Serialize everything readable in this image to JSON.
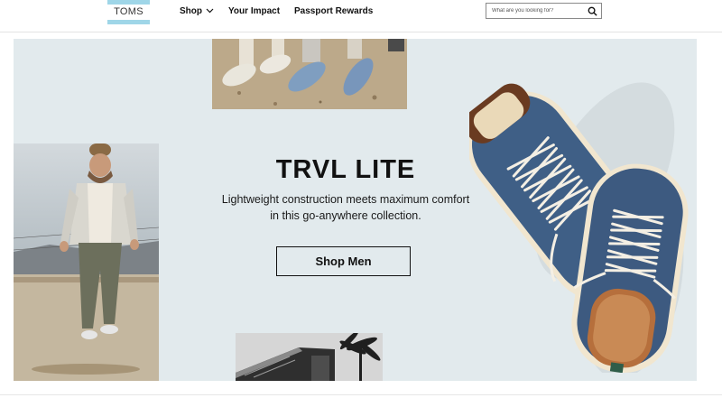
{
  "header": {
    "logo_text": "TOMS",
    "nav": [
      {
        "label": "Shop",
        "has_dropdown": true
      },
      {
        "label": "Your Impact",
        "has_dropdown": false
      },
      {
        "label": "Passport Rewards",
        "has_dropdown": false
      }
    ],
    "search": {
      "placeholder": "What are you looking for?",
      "value": "",
      "icon": "search-icon"
    }
  },
  "hero": {
    "title": "TRVL LITE",
    "subtitle_line1": "Lightweight construction meets maximum comfort",
    "subtitle_line2": "in this go-anywhere collection.",
    "cta_label": "Shop Men",
    "background_color": "#e2eaed",
    "brand_color": "#9fd6e8"
  }
}
